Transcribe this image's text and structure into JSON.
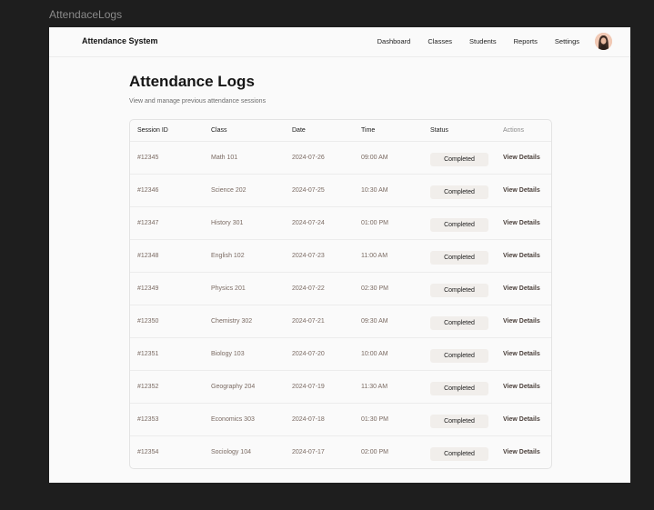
{
  "frame_label": "AttendaceLogs",
  "navbar": {
    "brand": "Attendance System",
    "links": [
      "Dashboard",
      "Classes",
      "Students",
      "Reports",
      "Settings"
    ]
  },
  "page": {
    "title": "Attendance Logs",
    "subtitle": "View and manage previous attendance sessions"
  },
  "table": {
    "headers": [
      "Session ID",
      "Class",
      "Date",
      "Time",
      "Status",
      "Actions"
    ],
    "action_label": "View Details",
    "rows": [
      {
        "id": "#12345",
        "class": "Math 101",
        "date": "2024-07-26",
        "time": "09:00 AM",
        "status": "Completed"
      },
      {
        "id": "#12346",
        "class": "Science 202",
        "date": "2024-07-25",
        "time": "10:30 AM",
        "status": "Completed"
      },
      {
        "id": "#12347",
        "class": "History 301",
        "date": "2024-07-24",
        "time": "01:00 PM",
        "status": "Completed"
      },
      {
        "id": "#12348",
        "class": "English 102",
        "date": "2024-07-23",
        "time": "11:00 AM",
        "status": "Completed"
      },
      {
        "id": "#12349",
        "class": "Physics 201",
        "date": "2024-07-22",
        "time": "02:30 PM",
        "status": "Completed"
      },
      {
        "id": "#12350",
        "class": "Chemistry 302",
        "date": "2024-07-21",
        "time": "09:30 AM",
        "status": "Completed"
      },
      {
        "id": "#12351",
        "class": "Biology 103",
        "date": "2024-07-20",
        "time": "10:00 AM",
        "status": "Completed"
      },
      {
        "id": "#12352",
        "class": "Geography 204",
        "date": "2024-07-19",
        "time": "11:30 AM",
        "status": "Completed"
      },
      {
        "id": "#12353",
        "class": "Economics 303",
        "date": "2024-07-18",
        "time": "01:30 PM",
        "status": "Completed"
      },
      {
        "id": "#12354",
        "class": "Sociology 104",
        "date": "2024-07-17",
        "time": "02:00 PM",
        "status": "Completed"
      }
    ]
  }
}
